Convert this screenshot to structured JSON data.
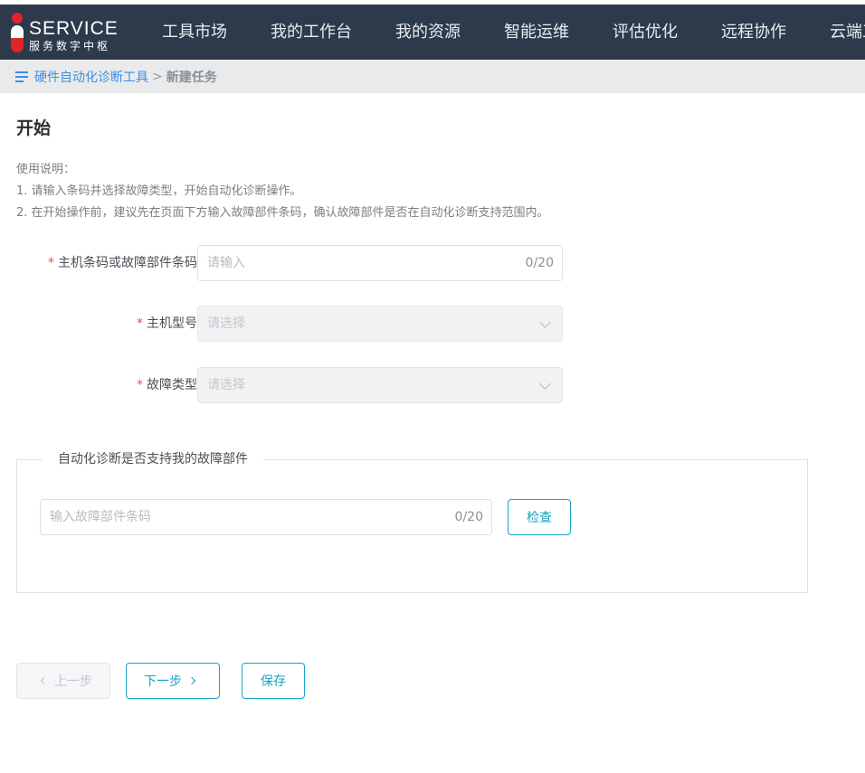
{
  "header": {
    "logo_title": "SERVICE",
    "logo_subtitle": "服务数字中枢",
    "nav": [
      "工具市场",
      "我的工作台",
      "我的资源",
      "智能运维",
      "评估优化",
      "远程协作",
      "云端工"
    ]
  },
  "breadcrumb": {
    "parent": "硬件自动化诊断工具",
    "separator": ">",
    "current": "新建任务"
  },
  "page": {
    "title": "开始",
    "instructions": [
      "使用说明：",
      "1. 请输入条码并选择故障类型，开始自动化诊断操作。",
      "2. 在开始操作前，建议先在页面下方输入故障部件条码，确认故障部件是否在自动化诊断支持范围内。"
    ]
  },
  "form": {
    "required_mark": "*",
    "barcode": {
      "label": "主机条码或故障部件条码",
      "placeholder": "请输入",
      "value": "",
      "count": "0/20"
    },
    "model": {
      "label": "主机型号",
      "placeholder": "请选择"
    },
    "fault_type": {
      "label": "故障类型",
      "placeholder": "请选择"
    }
  },
  "support_check": {
    "legend": "自动化诊断是否支持我的故障部件",
    "placeholder": "输入故障部件条码",
    "value": "",
    "count": "0/20",
    "button": "检查"
  },
  "actions": {
    "prev": "上一步",
    "next": "下一步",
    "save": "保存"
  },
  "colors": {
    "header_bg": "#2d3a4b",
    "accent": "#17a2c6",
    "link": "#3a8ee6",
    "required": "#e5534b"
  }
}
